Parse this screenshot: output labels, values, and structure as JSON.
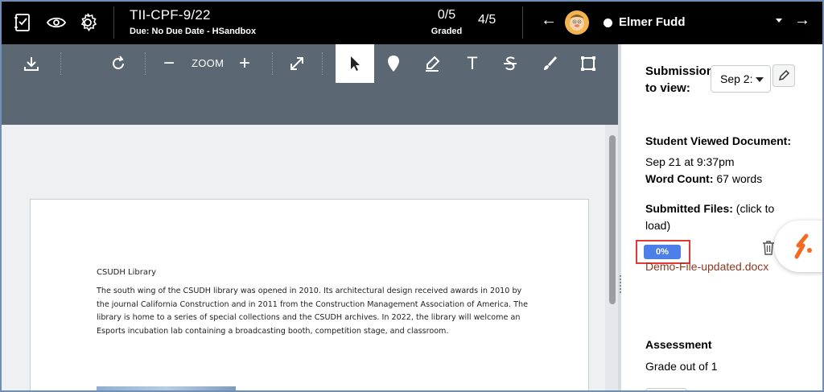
{
  "header": {
    "assignment_title": "TII-CPF-9/22",
    "due_text": "Due: No Due Date - HSandbox",
    "graded_count": "0/5",
    "graded_label": "Graded",
    "student_position": "4/5",
    "student_name": "Elmer Fudd",
    "prev_arrow": "←",
    "next_arrow": "→"
  },
  "toolbar": {
    "zoom_label": "ZOOM",
    "zoom_out": "−",
    "zoom_in": "+",
    "text_tool": "T",
    "strike_tool": "S"
  },
  "document": {
    "heading": "CSUDH Library",
    "body": "The south wing of the CSUDH library was opened in 2010. Its architectural design received awards in 2010 by the journal California Construction and in 2011 from the Construction Management Association of America. The library is home to a series of special collections and the CSUDH archives. In 2022, the library will welcome an Esports incubation lab containing a broadcasting booth, competition stage, and classroom."
  },
  "panel": {
    "submission_label": "Submission to view:",
    "submission_selected": "Sep 2:",
    "viewed_label": "Student Viewed Document:",
    "viewed_date": "Sep 21 at 9:37pm",
    "word_count_label": "Word Count:",
    "word_count_value": "67 words",
    "files_label": "Submitted Files:",
    "files_hint": "(click to load)",
    "progress_text": "0%",
    "file_name": "Demo-File-updated.docx",
    "assessment_label": "Assessment",
    "grade_out_of": "Grade out of 1"
  },
  "colors": {
    "topbar": "#000000",
    "toolbar": "#5b6773",
    "progress": "#4d7fe8",
    "highlight_outline": "#e53935",
    "file_link": "#8b3a22",
    "brand_icon": "#f26b21"
  }
}
